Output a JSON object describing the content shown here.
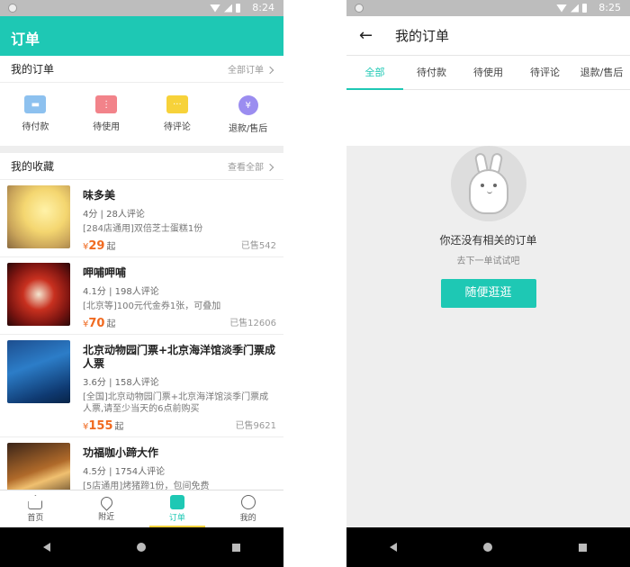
{
  "left": {
    "status": {
      "time": "8:24"
    },
    "appbar": {
      "title": "订单"
    },
    "my_orders": {
      "title": "我的订单",
      "more": "全部订单",
      "items": [
        {
          "label": "待付款",
          "icon": "pay-icon"
        },
        {
          "label": "待使用",
          "icon": "ticket-icon"
        },
        {
          "label": "待评论",
          "icon": "comment-icon"
        },
        {
          "label": "退款/售后",
          "icon": "yen-icon",
          "glyph": "¥"
        }
      ]
    },
    "favorites": {
      "title": "我的收藏",
      "more": "查看全部",
      "deals": [
        {
          "name": "味多美",
          "rating": "4分 | 28人评论",
          "desc": "[284店通用]双倍芝士蛋糕1份",
          "price": "29",
          "price_prefix": "¥",
          "price_suffix": "起",
          "sold": "已售542"
        },
        {
          "name": "呷哺呷哺",
          "rating": "4.1分 | 198人评论",
          "desc": "[北京等]100元代金券1张，可叠加",
          "price": "70",
          "price_prefix": "¥",
          "price_suffix": "起",
          "sold": "已售12606"
        },
        {
          "name": "北京动物园门票+北京海洋馆淡季门票成人票",
          "rating": "3.6分 | 158人评论",
          "desc": "[全国]北京动物园门票+北京海洋馆淡季门票成人票,请至少当天的6点前购买",
          "price": "155",
          "price_prefix": "¥",
          "price_suffix": "起",
          "sold": "已售9621"
        },
        {
          "name": "功福咖小蹄大作",
          "rating": "4.5分 | 1754人评论",
          "desc": "[5店通用]烤猪蹄1份，包间免费"
        }
      ]
    },
    "tabbar": [
      {
        "label": "首页",
        "icon": "home-icon"
      },
      {
        "label": "附近",
        "icon": "location-pin-icon"
      },
      {
        "label": "订单",
        "icon": "order-icon"
      },
      {
        "label": "我的",
        "icon": "profile-icon"
      }
    ],
    "accent": "#1ec8b4"
  },
  "right": {
    "status": {
      "time": "8:25"
    },
    "toolbar": {
      "title": "我的订单",
      "back": "←"
    },
    "tabs": [
      "全部",
      "待付款",
      "待使用",
      "待评论",
      "退款/售后"
    ],
    "empty": {
      "title": "你还没有相关的订单",
      "subtitle": "去下一单试试吧",
      "button": "随便逛逛"
    }
  }
}
